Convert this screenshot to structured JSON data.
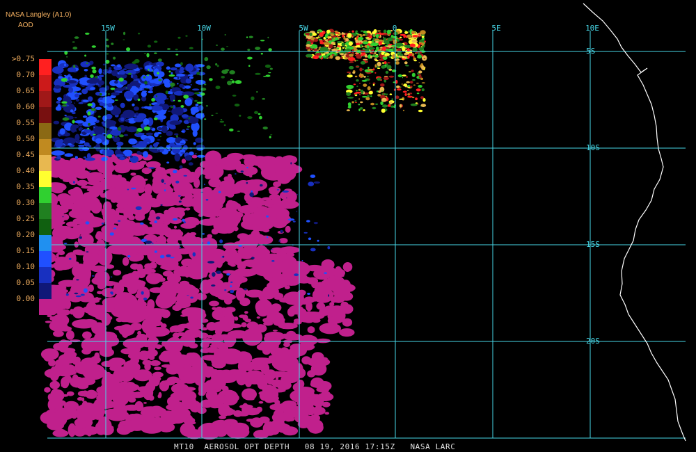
{
  "header": {
    "credit": "NASA Langley (A1.0)",
    "units": "AOD"
  },
  "graticule": {
    "lon_labels": [
      "15W",
      "10W",
      "5W",
      "0",
      "5E",
      "10E"
    ],
    "lat_labels": [
      "5S",
      "10S",
      "15S",
      "20S"
    ]
  },
  "legend": {
    "ticks": [
      ">0.75",
      "0.70",
      "0.65",
      "0.60",
      "0.55",
      "0.50",
      "0.45",
      "0.40",
      "0.35",
      "0.30",
      "0.25",
      "0.20",
      "0.15",
      "0.10",
      "0.05",
      "0.00"
    ],
    "colors": [
      "#ff2020",
      "#cc1a1a",
      "#a01818",
      "#781010",
      "#8b6914",
      "#c08a20",
      "#e8b850",
      "#ffff30",
      "#30d030",
      "#208020",
      "#106010",
      "#2090f0",
      "#2050ff",
      "#1830c0",
      "#101878",
      "#c0208c"
    ]
  },
  "colors": {
    "grid": "#48d8e8",
    "coast": "#ffffff",
    "label": "#f4b060",
    "low_aod": "#c0208c",
    "background": "#000000"
  },
  "footer": {
    "text": "MT10  AEROSOL OPT DEPTH   08 19, 2016 17:15Z   NASA LARC"
  }
}
